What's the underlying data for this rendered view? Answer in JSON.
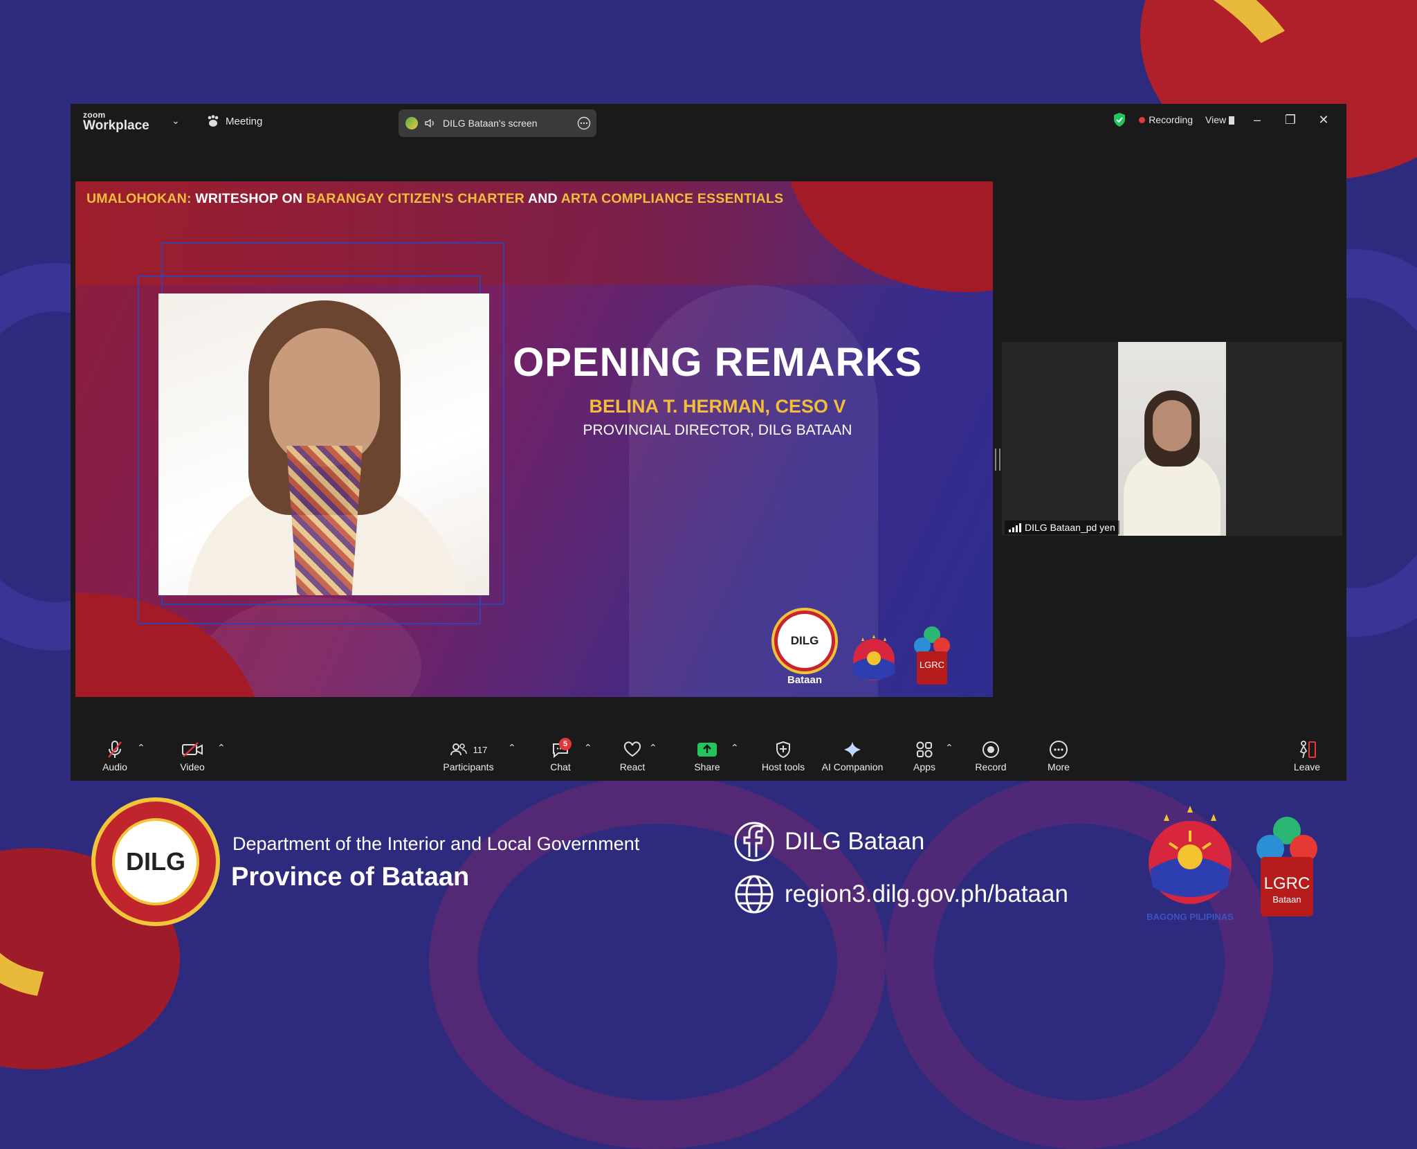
{
  "zoom": {
    "brand_top": "zoom",
    "brand_bottom": "Workplace",
    "meeting_label": "Meeting",
    "screen_share_label": "DILG Bataan's screen",
    "recording_label": "Recording",
    "view_label": "View"
  },
  "slide": {
    "headline": [
      {
        "text": "UMALOHOKAN: ",
        "color": "yellow"
      },
      {
        "text": "WRITESHOP ON ",
        "color": "white"
      },
      {
        "text": "BARANGAY CITIZEN'S CHARTER",
        "color": "yellow"
      },
      {
        "text": " AND ",
        "color": "white"
      },
      {
        "text": "ARTA COMPLIANCE ESSENTIALS",
        "color": "yellow"
      }
    ],
    "title": "OPENING REMARKS",
    "speaker_name": "BELINA T. HERMAN, CESO V",
    "speaker_position": "PROVINCIAL DIRECTOR, DILG BATAAN",
    "logo_dilg": "DILG",
    "logo_bataan": "Bataan",
    "logo_lgrc": "LGRC"
  },
  "participant": {
    "name": "DILG Bataan_pd yen"
  },
  "toolbar": {
    "audio": "Audio",
    "video": "Video",
    "participants": "Participants",
    "participants_count": "117",
    "chat": "Chat",
    "chat_badge": "5",
    "react": "React",
    "share": "Share",
    "host_tools": "Host tools",
    "ai_companion": "AI Companion",
    "apps": "Apps",
    "record": "Record",
    "more": "More",
    "leave": "Leave"
  },
  "footer": {
    "seal_text": "DILG",
    "department": "Department of the Interior and Local Government",
    "province": "Province of Bataan",
    "facebook": "DILG Bataan",
    "website": "region3.dilg.gov.ph/bataan",
    "bagong_pilipinas": "BAGONG PILIPINAS",
    "lgrc": "LGRC",
    "lgrc_sub": "Bataan"
  },
  "colors": {
    "background": "#2e2b7f",
    "accent_yellow": "#f2bd3a",
    "accent_red": "#b0202a",
    "share_green": "#22c55e",
    "record_red": "#e5373a"
  }
}
